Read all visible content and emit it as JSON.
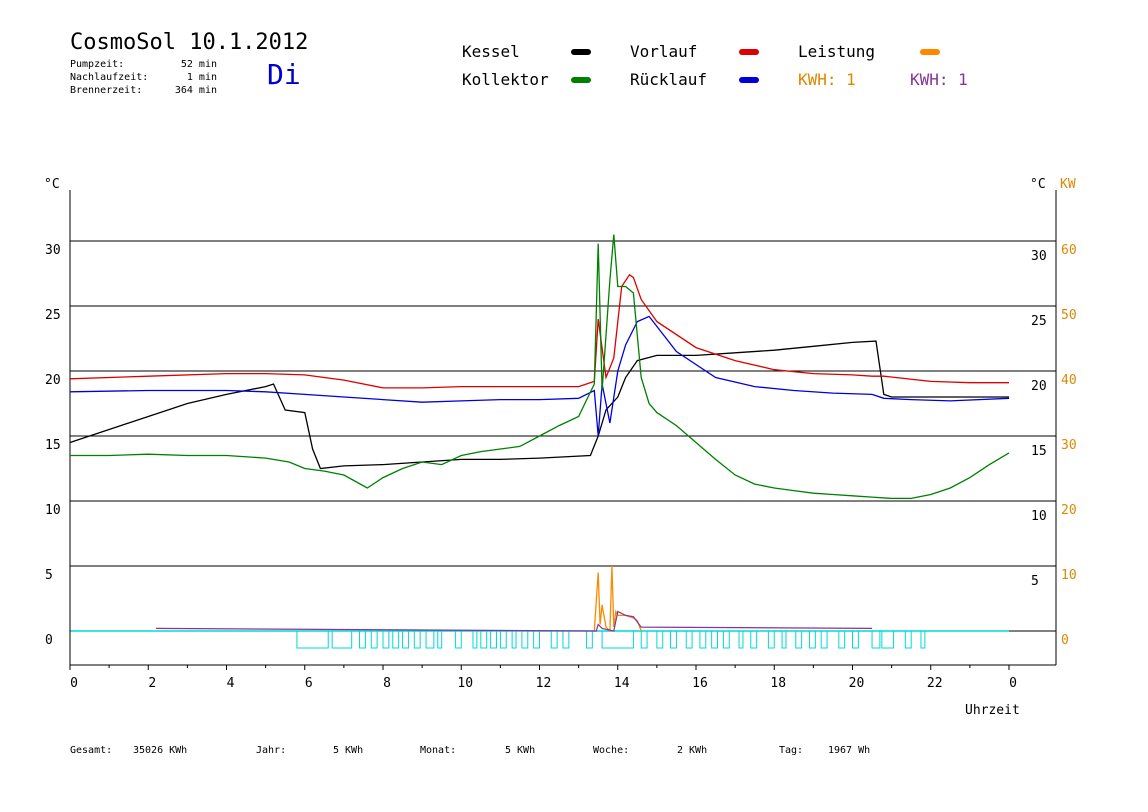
{
  "header": {
    "title": "CosmoSol 10.1.2012",
    "day": "Di",
    "stats": [
      {
        "label": "Pumpzeit:",
        "value": "52 min"
      },
      {
        "label": "Nachlaufzeit:",
        "value": "1 min"
      },
      {
        "label": "Brennerzeit:",
        "value": "364 min"
      }
    ]
  },
  "legend": {
    "items": [
      {
        "label": "Kessel",
        "color": "#000000"
      },
      {
        "label": "Vorlauf",
        "color": "#dd0000"
      },
      {
        "label": "Leistung",
        "color": "#ff8800"
      },
      {
        "label": "Kollektor",
        "color": "#008000"
      },
      {
        "label": "Rücklauf",
        "color": "#0000dd"
      }
    ],
    "kwh_orange": {
      "text": "KWH: 1",
      "color": "#dd8800"
    },
    "kwh_purple": {
      "text": "KWH: 1",
      "color": "#883399"
    }
  },
  "footer": {
    "gesamt_label": "Gesamt:",
    "gesamt_value": "35026 KWh",
    "jahr_label": "Jahr:",
    "jahr_value": "5 KWh",
    "monat_label": "Monat:",
    "monat_value": "5 KWh",
    "woche_label": "Woche:",
    "woche_value": "2 KWh",
    "tag_label": "Tag:",
    "tag_value": "1967 Wh"
  },
  "chart_data": {
    "type": "line",
    "xlabel": "Uhrzeit",
    "ylabel_left": "°C",
    "ylabel_right": "°C",
    "ylabel_right2": "KW",
    "xlim": [
      0,
      24
    ],
    "ylim": [
      0,
      30
    ],
    "y2lim": [
      0,
      60
    ],
    "x_ticks": [
      "0",
      "2",
      "4",
      "6",
      "8",
      "10",
      "12",
      "14",
      "16",
      "18",
      "20",
      "22",
      "0"
    ],
    "y_ticks": [
      "0",
      "5",
      "10",
      "15",
      "20",
      "25",
      "30"
    ],
    "y_ticks_right": [
      "5",
      "10",
      "15",
      "20",
      "25",
      "30"
    ],
    "y2_ticks": [
      "0",
      "10",
      "20",
      "30",
      "40",
      "50",
      "60"
    ],
    "grid": true,
    "series": [
      {
        "name": "Kessel",
        "color": "#000000",
        "x": [
          0,
          1,
          2,
          3,
          4,
          5,
          5.2,
          5.5,
          6,
          6.2,
          6.4,
          7,
          8,
          9,
          10,
          11,
          12,
          13.3,
          13.5,
          13.7,
          14,
          14.2,
          14.5,
          15,
          16,
          17,
          18,
          19,
          20,
          20.6,
          20.8,
          21,
          22,
          23,
          24
        ],
        "y": [
          14.5,
          15.5,
          16.5,
          17.5,
          18.2,
          18.8,
          19.0,
          17.0,
          16.8,
          14,
          12.5,
          12.7,
          12.8,
          13.0,
          13.2,
          13.2,
          13.3,
          13.5,
          15,
          17,
          18,
          19.5,
          20.8,
          21.2,
          21.2,
          21.4,
          21.6,
          21.9,
          22.2,
          22.3,
          18.2,
          18.0,
          18.0,
          18.0,
          18.0
        ]
      },
      {
        "name": "Vorlauf",
        "color": "#dd0000",
        "x": [
          0,
          2,
          4,
          5,
          6,
          7,
          8,
          9,
          10,
          11,
          12,
          13,
          13.4,
          13.5,
          13.7,
          13.9,
          14.1,
          14.3,
          14.4,
          14.6,
          15,
          16,
          17,
          18,
          19,
          20,
          20.5,
          20.8,
          22,
          23,
          24
        ],
        "y": [
          19.4,
          19.6,
          19.8,
          19.8,
          19.7,
          19.3,
          18.7,
          18.7,
          18.8,
          18.8,
          18.8,
          18.8,
          19.2,
          24,
          19.5,
          21,
          26.5,
          27.4,
          27.2,
          25.5,
          23.8,
          21.8,
          20.8,
          20.1,
          19.8,
          19.7,
          19.6,
          19.6,
          19.2,
          19.1,
          19.1
        ]
      },
      {
        "name": "Rücklauf",
        "color": "#0000dd",
        "x": [
          0,
          2,
          4,
          5,
          6,
          7,
          8,
          9,
          10,
          11,
          12,
          13,
          13.4,
          13.5,
          13.6,
          13.8,
          14,
          14.2,
          14.5,
          14.8,
          15.5,
          16.5,
          17.5,
          18.5,
          19.5,
          20.5,
          20.8,
          21.5,
          22.5,
          24
        ],
        "y": [
          18.4,
          18.5,
          18.5,
          18.4,
          18.2,
          18.0,
          17.8,
          17.6,
          17.7,
          17.8,
          17.8,
          17.9,
          18.5,
          15,
          19,
          16,
          20,
          22,
          23.8,
          24.2,
          21.5,
          19.5,
          18.8,
          18.5,
          18.3,
          18.2,
          17.9,
          17.8,
          17.7,
          17.9
        ]
      },
      {
        "name": "Kollektor",
        "color": "#008000",
        "x": [
          0,
          1,
          2,
          3,
          4,
          5,
          5.6,
          6,
          6.5,
          7,
          7.3,
          7.6,
          8,
          8.5,
          9,
          9.5,
          10,
          10.5,
          11,
          11.5,
          12,
          12.5,
          13,
          13.4,
          13.5,
          13.6,
          13.8,
          13.9,
          14,
          14.2,
          14.4,
          14.6,
          14.8,
          15,
          15.5,
          16,
          16.5,
          17,
          17.5,
          18,
          18.5,
          19,
          19.5,
          20,
          20.5,
          21,
          21.5,
          22,
          22.5,
          23,
          23.5,
          24
        ],
        "y": [
          13.5,
          13.5,
          13.6,
          13.5,
          13.5,
          13.3,
          13.0,
          12.5,
          12.3,
          12.0,
          11.5,
          11.0,
          11.8,
          12.5,
          13.0,
          12.8,
          13.5,
          13.8,
          14.0,
          14.2,
          15.0,
          15.8,
          16.5,
          19.0,
          29.8,
          18.5,
          27.0,
          30.5,
          26.5,
          26.5,
          26.0,
          19.5,
          17.5,
          16.8,
          15.8,
          14.5,
          13.2,
          12.0,
          11.3,
          11.0,
          10.8,
          10.6,
          10.5,
          10.4,
          10.3,
          10.2,
          10.2,
          10.5,
          11.0,
          11.8,
          12.8,
          13.7
        ]
      },
      {
        "name": "Leistung",
        "color": "#ff8800",
        "x": [
          13.4,
          13.5,
          13.55,
          13.6,
          13.7,
          13.8,
          13.85,
          13.9,
          13.95,
          14,
          14.2,
          14.4,
          14.5,
          14.6
        ],
        "y": [
          0,
          4.5,
          0.5,
          2,
          0.3,
          0,
          5,
          0.3,
          1.5,
          1.2,
          1.2,
          1.0,
          0.8,
          0
        ]
      }
    ],
    "kwh_purple_series": {
      "x": [
        2.2,
        13.45,
        13.5,
        13.6,
        13.9,
        14.0,
        14.2,
        14.4,
        14.6,
        20.5
      ],
      "y": [
        0.2,
        0,
        0.5,
        0.2,
        0,
        1.5,
        1.2,
        1.1,
        0.3,
        0.2
      ]
    },
    "pump_pulses": [
      [
        5.8,
        6.6
      ],
      [
        6.7,
        7.2
      ],
      [
        7.4,
        7.55
      ],
      [
        7.7,
        7.85
      ],
      [
        8.0,
        8.15
      ],
      [
        8.25,
        8.4
      ],
      [
        8.5,
        8.65
      ],
      [
        8.8,
        8.95
      ],
      [
        9.1,
        9.3
      ],
      [
        9.4,
        9.5
      ],
      [
        9.85,
        10.0
      ],
      [
        10.3,
        10.4
      ],
      [
        10.5,
        10.65
      ],
      [
        10.75,
        10.9
      ],
      [
        11.0,
        11.15
      ],
      [
        11.3,
        11.4
      ],
      [
        11.55,
        11.7
      ],
      [
        11.85,
        12.0
      ],
      [
        12.3,
        12.45
      ],
      [
        12.6,
        12.75
      ],
      [
        13.2,
        13.35
      ],
      [
        13.6,
        14.4
      ],
      [
        14.6,
        14.75
      ],
      [
        15.0,
        15.15
      ],
      [
        15.35,
        15.5
      ],
      [
        15.75,
        15.9
      ],
      [
        16.1,
        16.25
      ],
      [
        16.4,
        16.55
      ],
      [
        16.7,
        16.85
      ],
      [
        17.1,
        17.2
      ],
      [
        17.4,
        17.55
      ],
      [
        17.85,
        18.0
      ],
      [
        18.2,
        18.3
      ],
      [
        18.55,
        18.7
      ],
      [
        18.9,
        19.05
      ],
      [
        19.2,
        19.35
      ],
      [
        19.65,
        19.8
      ],
      [
        20.0,
        20.15
      ],
      [
        20.5,
        20.7
      ],
      [
        20.75,
        21.05
      ],
      [
        21.35,
        21.5
      ],
      [
        21.75,
        21.85
      ]
    ]
  }
}
